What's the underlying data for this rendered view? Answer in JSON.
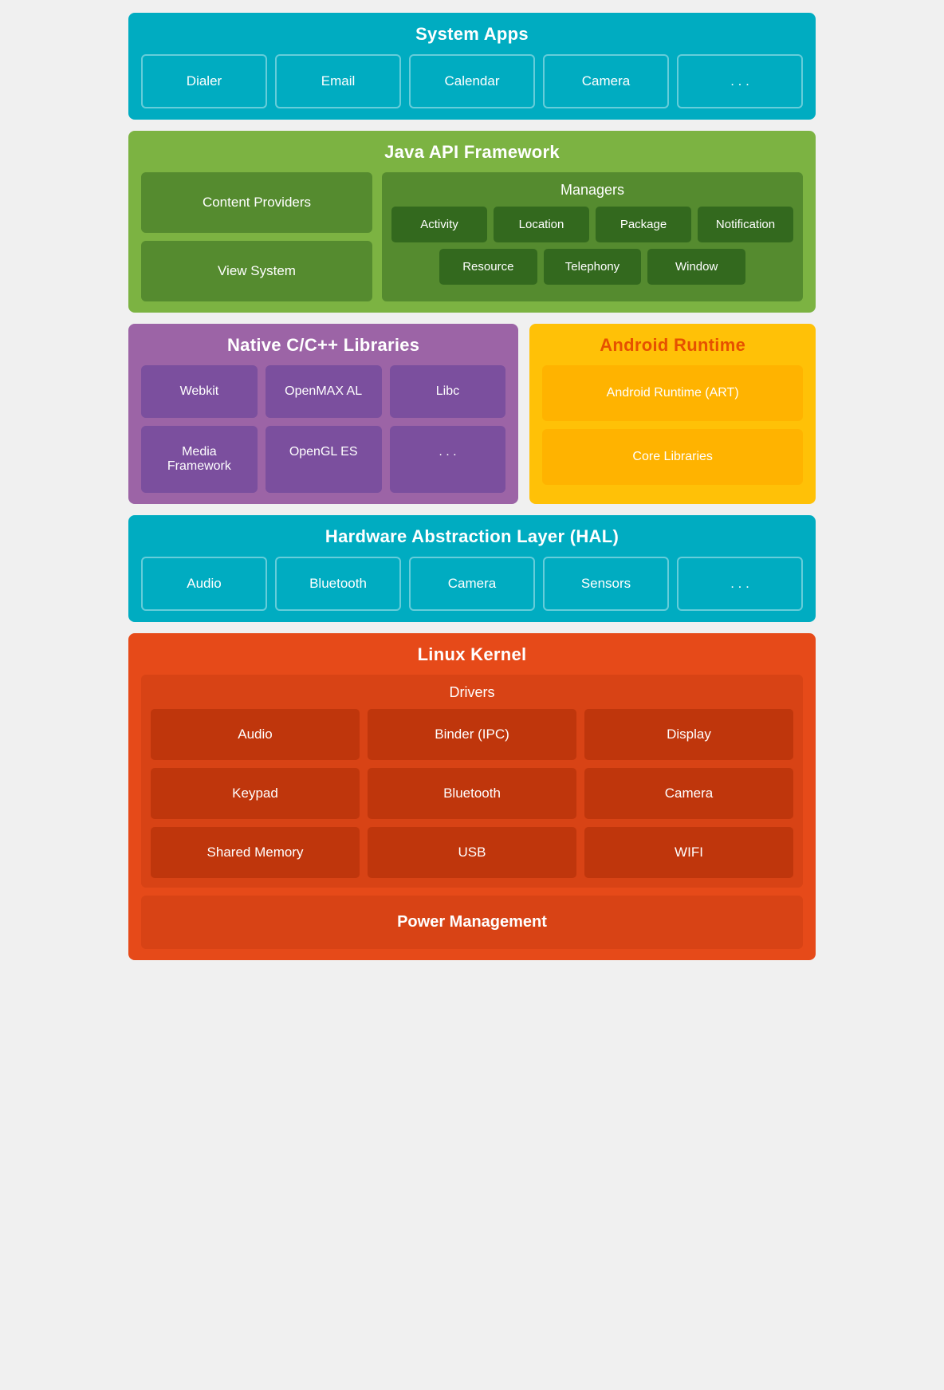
{
  "system_apps": {
    "title": "System Apps",
    "cards": [
      "Dialer",
      "Email",
      "Calendar",
      "Camera",
      ". . ."
    ]
  },
  "java_api": {
    "title": "Java API Framework",
    "left": [
      "Content Providers",
      "View System"
    ],
    "managers_title": "Managers",
    "managers_row1": [
      "Activity",
      "Location",
      "Package",
      "Notification"
    ],
    "managers_row2": [
      "Resource",
      "Telephony",
      "Window"
    ]
  },
  "native_libs": {
    "title": "Native C/C++ Libraries",
    "cards": [
      "Webkit",
      "OpenMAX AL",
      "Libc",
      "Media Framework",
      "OpenGL ES",
      ". . ."
    ]
  },
  "android_runtime": {
    "title": "Android Runtime",
    "cards": [
      "Android Runtime (ART)",
      "Core Libraries"
    ]
  },
  "hal": {
    "title": "Hardware Abstraction Layer (HAL)",
    "cards": [
      "Audio",
      "Bluetooth",
      "Camera",
      "Sensors",
      ". . ."
    ]
  },
  "linux_kernel": {
    "title": "Linux Kernel",
    "drivers_title": "Drivers",
    "drivers": [
      "Audio",
      "Binder (IPC)",
      "Display",
      "Keypad",
      "Bluetooth",
      "Camera",
      "Shared Memory",
      "USB",
      "WIFI"
    ],
    "power_management": "Power Management"
  }
}
